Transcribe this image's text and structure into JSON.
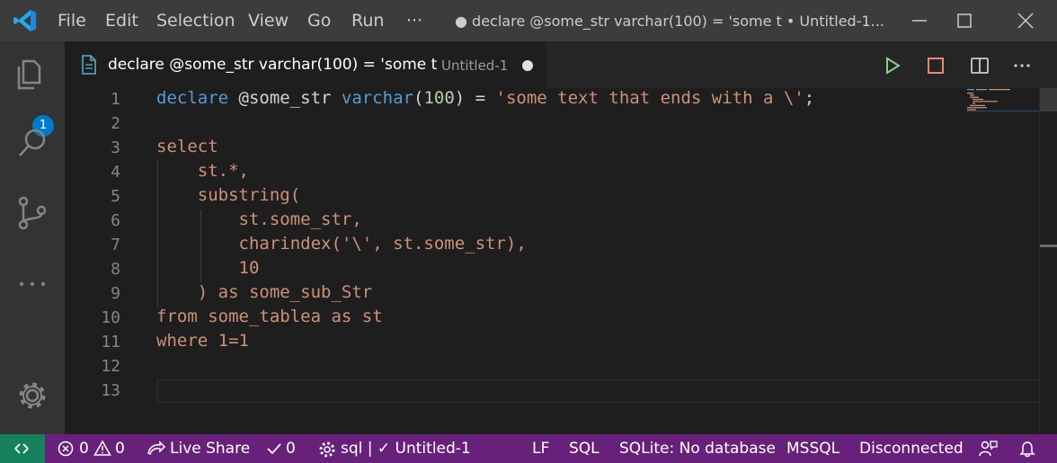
{
  "menu": {
    "file": "File",
    "edit": "Edit",
    "selection": "Selection",
    "view": "View",
    "go": "Go",
    "run": "Run",
    "more": "···"
  },
  "window_title": "● declare @some_str varchar(100) = 'some t • Untitled-1...",
  "tab": {
    "title": "declare @some_str varchar(100) = 'some t",
    "description": "Untitled-1"
  },
  "explorer_badge": "1",
  "line_numbers": [
    "1",
    "2",
    "3",
    "4",
    "5",
    "6",
    "7",
    "8",
    "9",
    "10",
    "11",
    "12",
    "13"
  ],
  "code": {
    "l1": {
      "kw1": "declare",
      "var": " @some_str ",
      "kw2": "varchar",
      "p1": "(",
      "num": "100",
      "p2": ") = ",
      "str": "'some text that ends with a \\'",
      "end": ";"
    },
    "l3": "select",
    "l4": "    st.*,",
    "l5": "    substring(",
    "l6": "        st.some_str,",
    "l7": "        charindex('\\', st.some_str),",
    "l8": "        10",
    "l9": "    ) as some_sub_Str",
    "l10": "from some_tablea as st",
    "l11": "where 1=1"
  },
  "status": {
    "errors": "0",
    "warnings": "0",
    "live_share": "Live Share",
    "check_count": "0",
    "sql_status": "sql | ✓ Untitled-1",
    "eol": "LF",
    "language": "SQL",
    "sqlite": "SQLite: No database",
    "mssql": "MSSQL",
    "connection": "Disconnected"
  },
  "colors": {
    "accent": "#007acc",
    "statusbar": "#68217a",
    "remote": "#16825d",
    "keyword": "#569cd6",
    "string": "#ce9178",
    "number": "#b5cea8"
  }
}
